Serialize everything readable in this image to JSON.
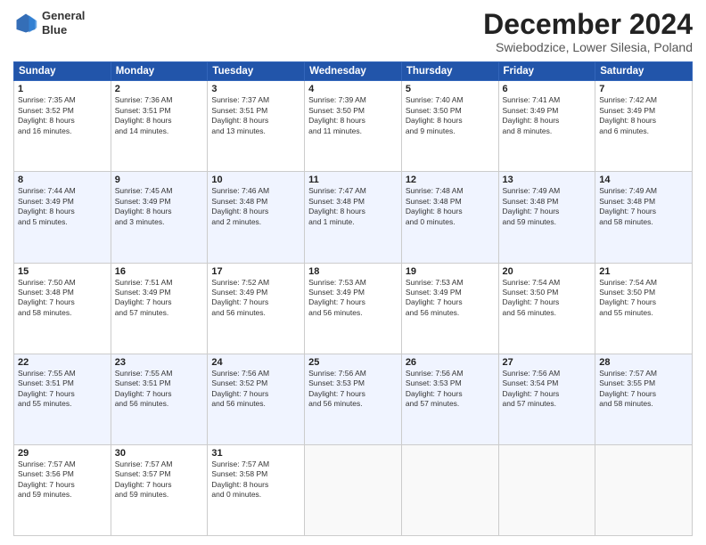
{
  "header": {
    "logo_line1": "General",
    "logo_line2": "Blue",
    "month_title": "December 2024",
    "subtitle": "Swiebodzice, Lower Silesia, Poland"
  },
  "days_of_week": [
    "Sunday",
    "Monday",
    "Tuesday",
    "Wednesday",
    "Thursday",
    "Friday",
    "Saturday"
  ],
  "weeks": [
    [
      {
        "day": "1",
        "info": "Sunrise: 7:35 AM\nSunset: 3:52 PM\nDaylight: 8 hours\nand 16 minutes."
      },
      {
        "day": "2",
        "info": "Sunrise: 7:36 AM\nSunset: 3:51 PM\nDaylight: 8 hours\nand 14 minutes."
      },
      {
        "day": "3",
        "info": "Sunrise: 7:37 AM\nSunset: 3:51 PM\nDaylight: 8 hours\nand 13 minutes."
      },
      {
        "day": "4",
        "info": "Sunrise: 7:39 AM\nSunset: 3:50 PM\nDaylight: 8 hours\nand 11 minutes."
      },
      {
        "day": "5",
        "info": "Sunrise: 7:40 AM\nSunset: 3:50 PM\nDaylight: 8 hours\nand 9 minutes."
      },
      {
        "day": "6",
        "info": "Sunrise: 7:41 AM\nSunset: 3:49 PM\nDaylight: 8 hours\nand 8 minutes."
      },
      {
        "day": "7",
        "info": "Sunrise: 7:42 AM\nSunset: 3:49 PM\nDaylight: 8 hours\nand 6 minutes."
      }
    ],
    [
      {
        "day": "8",
        "info": "Sunrise: 7:44 AM\nSunset: 3:49 PM\nDaylight: 8 hours\nand 5 minutes."
      },
      {
        "day": "9",
        "info": "Sunrise: 7:45 AM\nSunset: 3:49 PM\nDaylight: 8 hours\nand 3 minutes."
      },
      {
        "day": "10",
        "info": "Sunrise: 7:46 AM\nSunset: 3:48 PM\nDaylight: 8 hours\nand 2 minutes."
      },
      {
        "day": "11",
        "info": "Sunrise: 7:47 AM\nSunset: 3:48 PM\nDaylight: 8 hours\nand 1 minute."
      },
      {
        "day": "12",
        "info": "Sunrise: 7:48 AM\nSunset: 3:48 PM\nDaylight: 8 hours\nand 0 minutes."
      },
      {
        "day": "13",
        "info": "Sunrise: 7:49 AM\nSunset: 3:48 PM\nDaylight: 7 hours\nand 59 minutes."
      },
      {
        "day": "14",
        "info": "Sunrise: 7:49 AM\nSunset: 3:48 PM\nDaylight: 7 hours\nand 58 minutes."
      }
    ],
    [
      {
        "day": "15",
        "info": "Sunrise: 7:50 AM\nSunset: 3:48 PM\nDaylight: 7 hours\nand 58 minutes."
      },
      {
        "day": "16",
        "info": "Sunrise: 7:51 AM\nSunset: 3:49 PM\nDaylight: 7 hours\nand 57 minutes."
      },
      {
        "day": "17",
        "info": "Sunrise: 7:52 AM\nSunset: 3:49 PM\nDaylight: 7 hours\nand 56 minutes."
      },
      {
        "day": "18",
        "info": "Sunrise: 7:53 AM\nSunset: 3:49 PM\nDaylight: 7 hours\nand 56 minutes."
      },
      {
        "day": "19",
        "info": "Sunrise: 7:53 AM\nSunset: 3:49 PM\nDaylight: 7 hours\nand 56 minutes."
      },
      {
        "day": "20",
        "info": "Sunrise: 7:54 AM\nSunset: 3:50 PM\nDaylight: 7 hours\nand 56 minutes."
      },
      {
        "day": "21",
        "info": "Sunrise: 7:54 AM\nSunset: 3:50 PM\nDaylight: 7 hours\nand 55 minutes."
      }
    ],
    [
      {
        "day": "22",
        "info": "Sunrise: 7:55 AM\nSunset: 3:51 PM\nDaylight: 7 hours\nand 55 minutes."
      },
      {
        "day": "23",
        "info": "Sunrise: 7:55 AM\nSunset: 3:51 PM\nDaylight: 7 hours\nand 56 minutes."
      },
      {
        "day": "24",
        "info": "Sunrise: 7:56 AM\nSunset: 3:52 PM\nDaylight: 7 hours\nand 56 minutes."
      },
      {
        "day": "25",
        "info": "Sunrise: 7:56 AM\nSunset: 3:53 PM\nDaylight: 7 hours\nand 56 minutes."
      },
      {
        "day": "26",
        "info": "Sunrise: 7:56 AM\nSunset: 3:53 PM\nDaylight: 7 hours\nand 57 minutes."
      },
      {
        "day": "27",
        "info": "Sunrise: 7:56 AM\nSunset: 3:54 PM\nDaylight: 7 hours\nand 57 minutes."
      },
      {
        "day": "28",
        "info": "Sunrise: 7:57 AM\nSunset: 3:55 PM\nDaylight: 7 hours\nand 58 minutes."
      }
    ],
    [
      {
        "day": "29",
        "info": "Sunrise: 7:57 AM\nSunset: 3:56 PM\nDaylight: 7 hours\nand 59 minutes."
      },
      {
        "day": "30",
        "info": "Sunrise: 7:57 AM\nSunset: 3:57 PM\nDaylight: 7 hours\nand 59 minutes."
      },
      {
        "day": "31",
        "info": "Sunrise: 7:57 AM\nSunset: 3:58 PM\nDaylight: 8 hours\nand 0 minutes."
      },
      {
        "day": "",
        "info": ""
      },
      {
        "day": "",
        "info": ""
      },
      {
        "day": "",
        "info": ""
      },
      {
        "day": "",
        "info": ""
      }
    ]
  ]
}
